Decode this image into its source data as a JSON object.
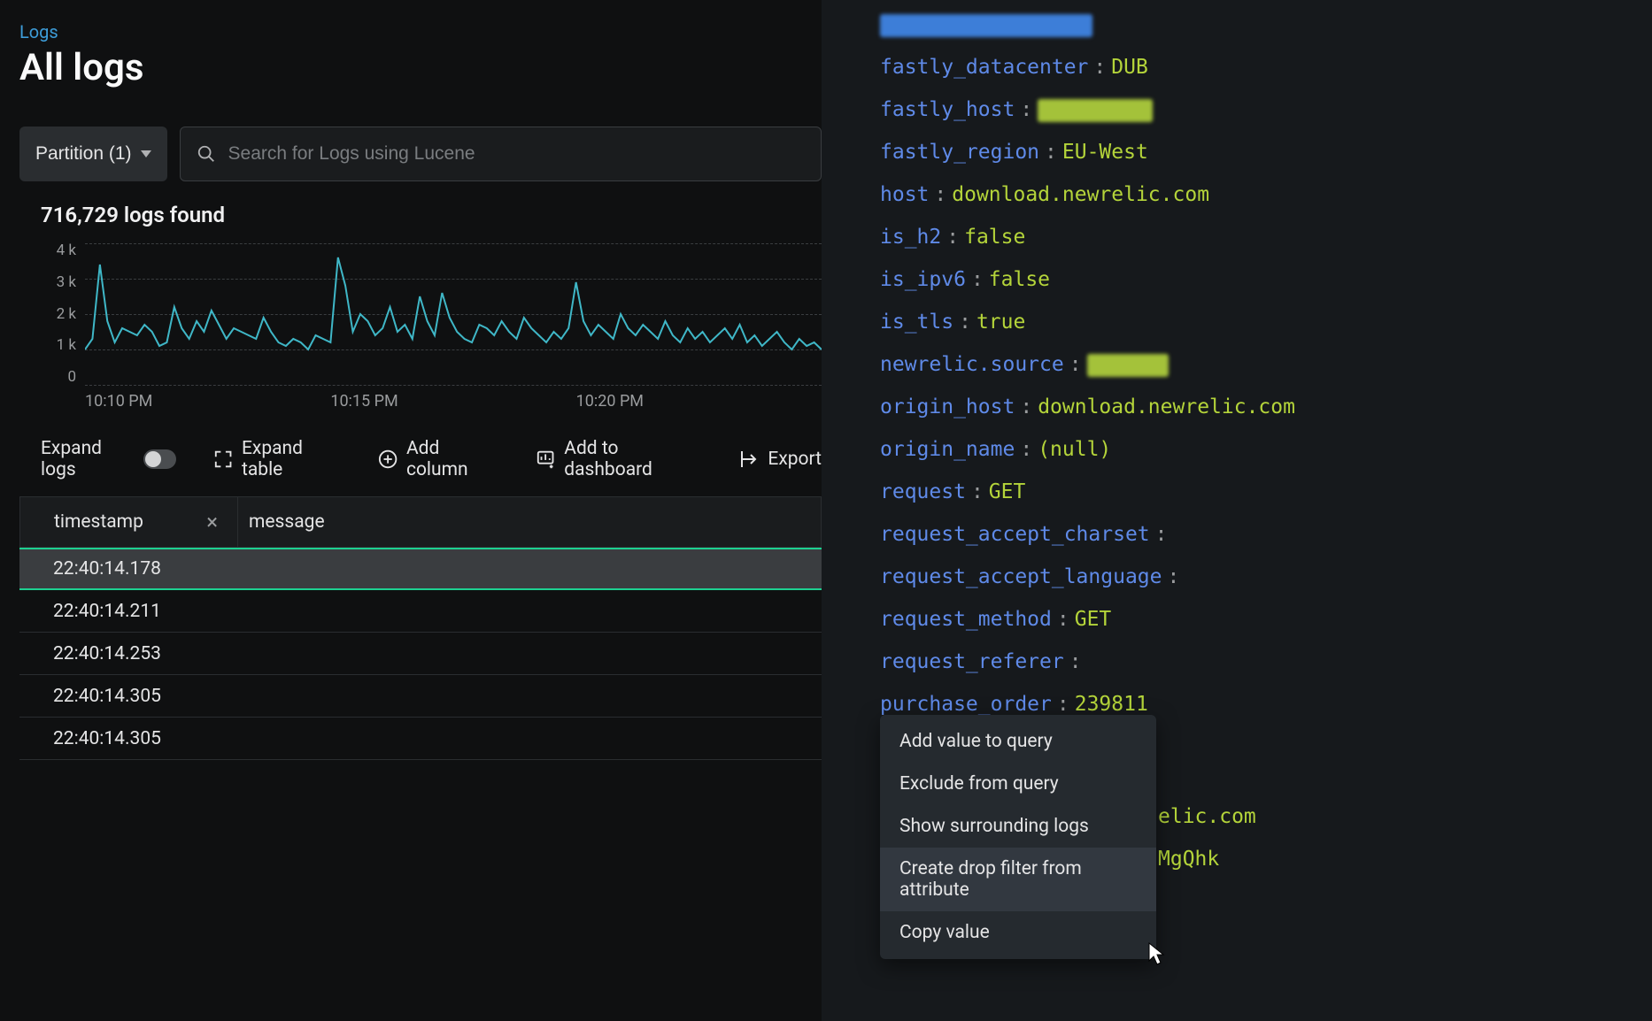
{
  "breadcrumb": "Logs",
  "title": "All logs",
  "partition_label": "Partition (1)",
  "search_placeholder": "Search for Logs using Lucene",
  "logs_found": "716,729 logs found",
  "chart_data": {
    "type": "line",
    "y_ticks": [
      "4 k",
      "3 k",
      "2 k",
      "1 k",
      "0"
    ],
    "x_ticks": [
      "10:10 PM",
      "10:15 PM",
      "10:20 PM"
    ],
    "ylim": [
      0,
      4000
    ],
    "values": [
      1000,
      1300,
      3400,
      1800,
      1200,
      1600,
      1500,
      1400,
      1700,
      1500,
      1100,
      1200,
      2200,
      1600,
      1300,
      1800,
      1500,
      2100,
      1700,
      1300,
      1600,
      1500,
      1400,
      1300,
      1900,
      1500,
      1200,
      1100,
      1300,
      1200,
      1000,
      1400,
      1300,
      1200,
      3600,
      2800,
      1500,
      2000,
      1800,
      1400,
      1600,
      2200,
      1500,
      1700,
      1300,
      2500,
      1800,
      1400,
      2600,
      1900,
      1500,
      1300,
      1200,
      1700,
      1600,
      1400,
      1800,
      1500,
      1300,
      1900,
      1600,
      1400,
      1200,
      1500,
      1300,
      1600,
      2900,
      1800,
      1400,
      1700,
      1500,
      1300,
      2000,
      1600,
      1400,
      1700,
      1500,
      1300,
      1800,
      1400,
      1200,
      1600,
      1300,
      1500,
      1200,
      1400,
      1600,
      1300,
      1700,
      1200,
      1400,
      1100,
      1300,
      1500,
      1200,
      1000,
      1300,
      1100,
      1200,
      1000
    ]
  },
  "toolbar": {
    "expand_logs": "Expand logs",
    "expand_table": "Expand table",
    "add_column": "Add column",
    "add_dashboard": "Add to dashboard",
    "export": "Export"
  },
  "columns": {
    "timestamp": "timestamp",
    "message": "message"
  },
  "rows": [
    "22:40:14.178",
    "22:40:14.211",
    "22:40:14.253",
    "22:40:14.305",
    "22:40:14.305"
  ],
  "attributes": [
    {
      "key": "fastly_datacenter",
      "val": "DUB"
    },
    {
      "key": "fastly_host",
      "redacted": "green"
    },
    {
      "key": "fastly_region",
      "val": "EU-West"
    },
    {
      "key": "host",
      "val": "download.newrelic.com"
    },
    {
      "key": "is_h2",
      "val": "false"
    },
    {
      "key": "is_ipv6",
      "val": "false"
    },
    {
      "key": "is_tls",
      "val": "true"
    },
    {
      "key": "newrelic.source",
      "redacted": "green2"
    },
    {
      "key": "origin_host",
      "val": "download.newrelic.com"
    },
    {
      "key": "origin_name",
      "val": "(null)"
    },
    {
      "key": "request",
      "val": "GET"
    },
    {
      "key": "request_accept_charset",
      "val": ""
    },
    {
      "key": "request_accept_language",
      "val": ""
    },
    {
      "key": "request_method",
      "val": "GET"
    },
    {
      "key": "request_referer",
      "val": ""
    },
    {
      "key": "purchase_order",
      "val": "239811"
    }
  ],
  "peek1": "elic.com",
  "peek2": "MgQhk",
  "ctx_menu": [
    "Add value to query",
    "Exclude from query",
    "Show surrounding logs",
    "Create drop filter from attribute",
    "Copy value"
  ]
}
